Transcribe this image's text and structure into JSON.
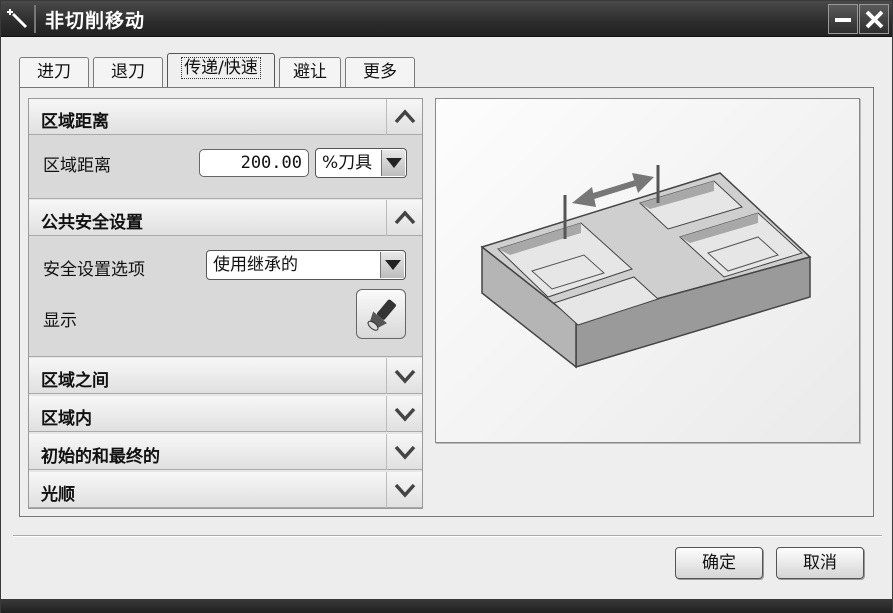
{
  "window": {
    "title": "非切削移动"
  },
  "tabs": [
    {
      "label": "进刀",
      "active": false
    },
    {
      "label": "退刀",
      "active": false
    },
    {
      "label": "传递/快速",
      "active": true
    },
    {
      "label": "避让",
      "active": false
    },
    {
      "label": "更多",
      "active": false
    }
  ],
  "sections": {
    "region_distance": {
      "title": "区域距离",
      "expanded": true,
      "field_label": "区域距离",
      "value": "200.00",
      "unit": "%刀具"
    },
    "common_safety": {
      "title": "公共安全设置",
      "expanded": true,
      "option_label": "安全设置选项",
      "option_value": "使用继承的",
      "display_label": "显示"
    },
    "between_regions": {
      "title": "区域之间",
      "expanded": false
    },
    "within_region": {
      "title": "区域内",
      "expanded": false
    },
    "initial_final": {
      "title": "初始的和最终的",
      "expanded": false
    },
    "smooth": {
      "title": "光顺",
      "expanded": false
    }
  },
  "icons": {
    "title": "wand-icon",
    "display": "flashlight-icon",
    "collapse": "chevron-up-icon",
    "expand": "chevron-down-icon"
  },
  "buttons": {
    "ok": "确定",
    "cancel": "取消"
  }
}
